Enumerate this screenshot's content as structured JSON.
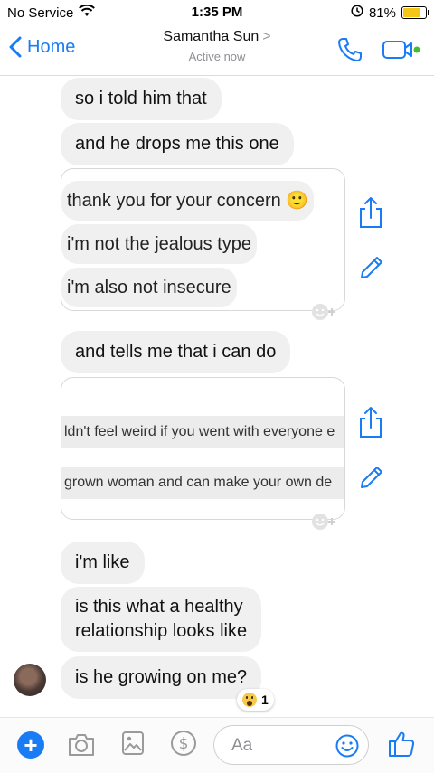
{
  "status_bar": {
    "carrier": "No Service",
    "time": "1:35 PM",
    "battery": "81%",
    "battery_level": 0.81
  },
  "header": {
    "back_label": "Home",
    "contact_name": "Samantha Sun",
    "chevron": ">",
    "status": "Active now"
  },
  "messages": [
    "so i told him that",
    "and he drops me this one",
    "and tells me that i can do",
    "i'm like",
    "is this what a healthy",
    "relationship looks like",
    "is he growing on me?"
  ],
  "shared_screenshot_1": {
    "lines": [
      "thank you for your concern 🙂",
      "i'm not the jealous type",
      "i'm also not insecure"
    ]
  },
  "shared_screenshot_2": {
    "lines": [
      "ldn't feel weird if you went with everyone e",
      "grown woman and can make your own de"
    ]
  },
  "reaction": {
    "emoji": "wow",
    "count": "1"
  },
  "composer": {
    "placeholder": "Aa"
  },
  "colors": {
    "accent": "#1a7cf5",
    "bubble": "#f0f0f0",
    "battery": "#f5c518",
    "active_dot": "#44bd32"
  },
  "icons": [
    "wifi-icon",
    "alarm-icon",
    "chevron-left-icon",
    "phone-icon",
    "video-icon",
    "share-icon",
    "pencil-icon",
    "add-reaction-icon",
    "plus-icon",
    "camera-icon",
    "image-icon",
    "dollar-icon",
    "emoji-icon",
    "thumbs-up-icon"
  ]
}
